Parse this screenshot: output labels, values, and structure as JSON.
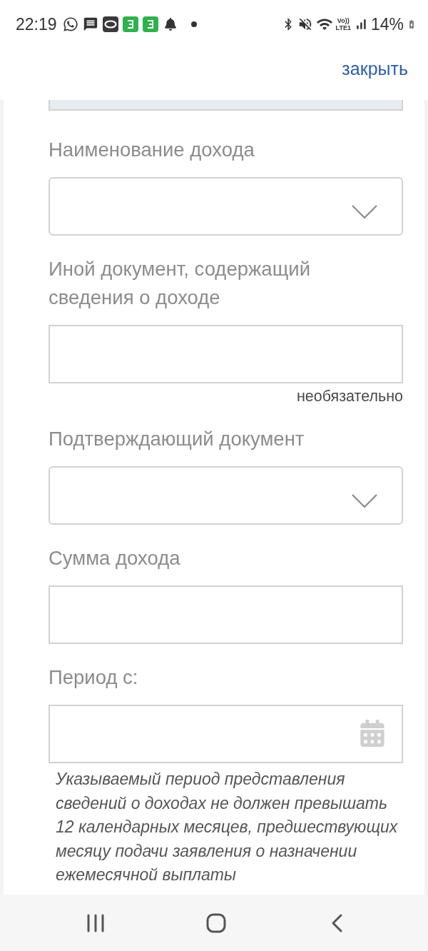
{
  "status_bar": {
    "time": "22:19",
    "network_label": [
      "Vo))",
      "LTE1"
    ],
    "battery": "14%"
  },
  "header": {
    "close_link": "закрыть"
  },
  "form": {
    "top_field": {
      "disabled": true
    },
    "fields": [
      {
        "kind": "select",
        "label": "Наименование дохода"
      },
      {
        "kind": "text",
        "label": "Иной документ, содержащий сведения о доходе",
        "note": "необязательно"
      },
      {
        "kind": "select",
        "label": "Подтверждающий документ"
      },
      {
        "kind": "text",
        "label": "Сумма дохода"
      },
      {
        "kind": "date",
        "label": "Период с:",
        "hint": "Указываемый период представления сведений о доходах не должен превышать 12 календарных месяцев, предшествующих месяцу подачи заявления о назначении ежемесячной выплаты"
      }
    ]
  }
}
